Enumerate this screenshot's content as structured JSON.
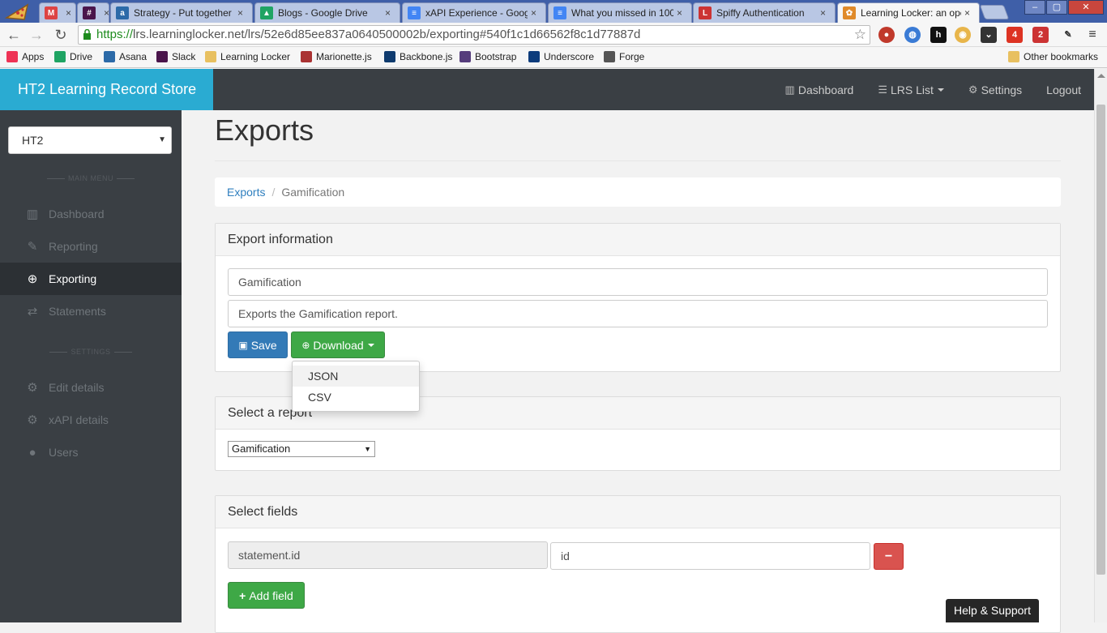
{
  "browser": {
    "tabs": [
      {
        "title": "",
        "icon_color": "#d44",
        "icon_text": "M"
      },
      {
        "title": "",
        "icon_color": "#4a154b",
        "icon_text": "#"
      },
      {
        "title": "Strategy - Put together",
        "icon_color": "#2c6aa8",
        "icon_text": "a"
      },
      {
        "title": "Blogs - Google Drive",
        "icon_color": "#1fa463",
        "icon_text": "▲"
      },
      {
        "title": "xAPI Experience - Googl",
        "icon_color": "#4285f4",
        "icon_text": "≡"
      },
      {
        "title": "What you missed in 100",
        "icon_color": "#4285f4",
        "icon_text": "≡"
      },
      {
        "title": "Spiffy Authentication",
        "icon_color": "#c33",
        "icon_text": "L"
      },
      {
        "title": "Learning Locker: an ope",
        "icon_color": "#e08a2a",
        "icon_text": "✿"
      }
    ],
    "tab_close": "×",
    "url_scheme": "https://",
    "url_rest": "lrs.learninglocker.net/lrs/52e6d85ee837a0640500002b/exporting#540f1c1d66562f8c1d77887d",
    "bookmarks": [
      {
        "label": "Apps",
        "color": "#e35"
      },
      {
        "label": "Drive",
        "color": "#1fa463"
      },
      {
        "label": "Asana",
        "color": "#2c6aa8"
      },
      {
        "label": "Slack",
        "color": "#4a154b"
      },
      {
        "label": "Learning Locker",
        "color": "#e8c060"
      },
      {
        "label": "Marionette.js",
        "color": "#a33"
      },
      {
        "label": "Backbone.js",
        "color": "#0f3b6e"
      },
      {
        "label": "Bootstrap",
        "color": "#563d7c"
      },
      {
        "label": "Underscore",
        "color": "#0d3c7c"
      },
      {
        "label": "Forge",
        "color": "#555"
      }
    ],
    "other_bookmarks": "Other bookmarks",
    "ext_badges": [
      "4",
      "2"
    ]
  },
  "app": {
    "brand": "HT2 Learning Record Store",
    "nav": {
      "dashboard": "Dashboard",
      "lrs_list": "LRS List",
      "settings": "Settings",
      "logout": "Logout"
    },
    "sidebar": {
      "selected_lrs": "HT2",
      "main_menu_label": "MAIN MENU",
      "settings_label": "SETTINGS",
      "main_items": [
        {
          "label": "Dashboard",
          "icon": "bar-chart-icon"
        },
        {
          "label": "Reporting",
          "icon": "pencil-icon"
        },
        {
          "label": "Exporting",
          "icon": "download-circle-icon",
          "active": true
        },
        {
          "label": "Statements",
          "icon": "exchange-icon"
        }
      ],
      "settings_items": [
        {
          "label": "Edit details",
          "icon": "gear-icon"
        },
        {
          "label": "xAPI details",
          "icon": "gears-icon"
        },
        {
          "label": "Users",
          "icon": "users-icon"
        }
      ]
    },
    "page_title": "Exports",
    "breadcrumb": {
      "parent": "Exports",
      "separator": "/",
      "current": "Gamification"
    },
    "export_info": {
      "heading": "Export information",
      "name_value": "Gamification",
      "description_value": "Exports the Gamification report.",
      "save_label": "Save",
      "download_label": "Download",
      "download_options": [
        "JSON",
        "CSV"
      ]
    },
    "report": {
      "heading": "Select a report",
      "selected": "Gamification"
    },
    "fields": {
      "heading": "Select fields",
      "rows": [
        {
          "key": "statement.id",
          "alias": "id"
        }
      ],
      "remove_label": "−",
      "add_label": "Add field"
    },
    "help_label": "Help & Support"
  }
}
